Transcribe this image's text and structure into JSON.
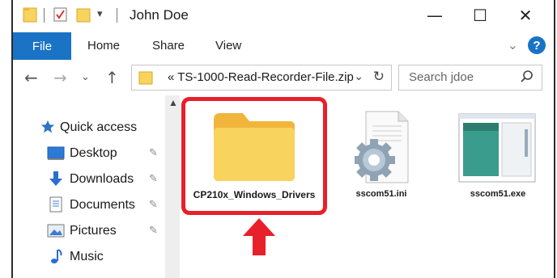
{
  "window": {
    "title": "John Doe",
    "controls": {
      "minimize": "—",
      "maximize": "☐",
      "close": "✕"
    }
  },
  "ribbon": {
    "tabs": [
      "File",
      "Home",
      "Share",
      "View"
    ],
    "help": "?"
  },
  "address_bar": {
    "path_prefix": "«",
    "path": "TS-1000-Read-Recorder-File.zip"
  },
  "search": {
    "placeholder": "Search jdoe"
  },
  "nav_pane": {
    "items": [
      {
        "label": "Quick access",
        "icon": "star-icon",
        "pinned": false
      },
      {
        "label": "Desktop",
        "icon": "desktop-icon",
        "pinned": true
      },
      {
        "label": "Downloads",
        "icon": "download-arrow-icon",
        "pinned": true
      },
      {
        "label": "Documents",
        "icon": "document-icon",
        "pinned": true
      },
      {
        "label": "Pictures",
        "icon": "pictures-icon",
        "pinned": true
      },
      {
        "label": "Music",
        "icon": "music-note-icon",
        "pinned": false
      }
    ]
  },
  "files": [
    {
      "name": "CP210x_Windows_Drivers",
      "type": "folder",
      "highlighted": true
    },
    {
      "name": "sscom51.ini",
      "type": "settings-file"
    },
    {
      "name": "sscom51.exe",
      "type": "application"
    }
  ],
  "colors": {
    "accent_blue": "#1a73c4",
    "highlight_red": "#e8202a",
    "folder_yellow": "#f8d35e"
  }
}
